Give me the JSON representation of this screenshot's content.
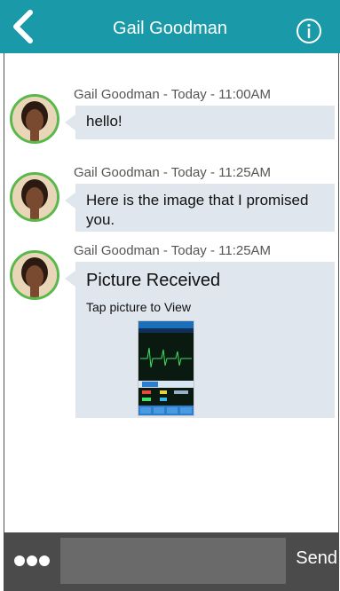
{
  "header": {
    "title": "Gail Goodman",
    "back_icon": "chevron-left-icon",
    "info_icon": "info-icon"
  },
  "messages": [
    {
      "meta": "Gail Goodman - Today - 11:00AM",
      "text": "hello!"
    },
    {
      "meta": "Gail Goodman - Today - 11:25AM",
      "text": "Here is the image that I promised you."
    },
    {
      "meta": "Gail Goodman - Today - 11:25AM",
      "title": "Picture Received",
      "subtitle": "Tap picture to View"
    }
  ],
  "footer": {
    "more_icon": "more-dots-icon",
    "input_placeholder": "",
    "send_label": "Send"
  },
  "colors": {
    "header": "#1a9aa9",
    "bubble": "#dfe6ee",
    "avatar_ring": "#58b84a",
    "footer": "#4b4b4b"
  }
}
